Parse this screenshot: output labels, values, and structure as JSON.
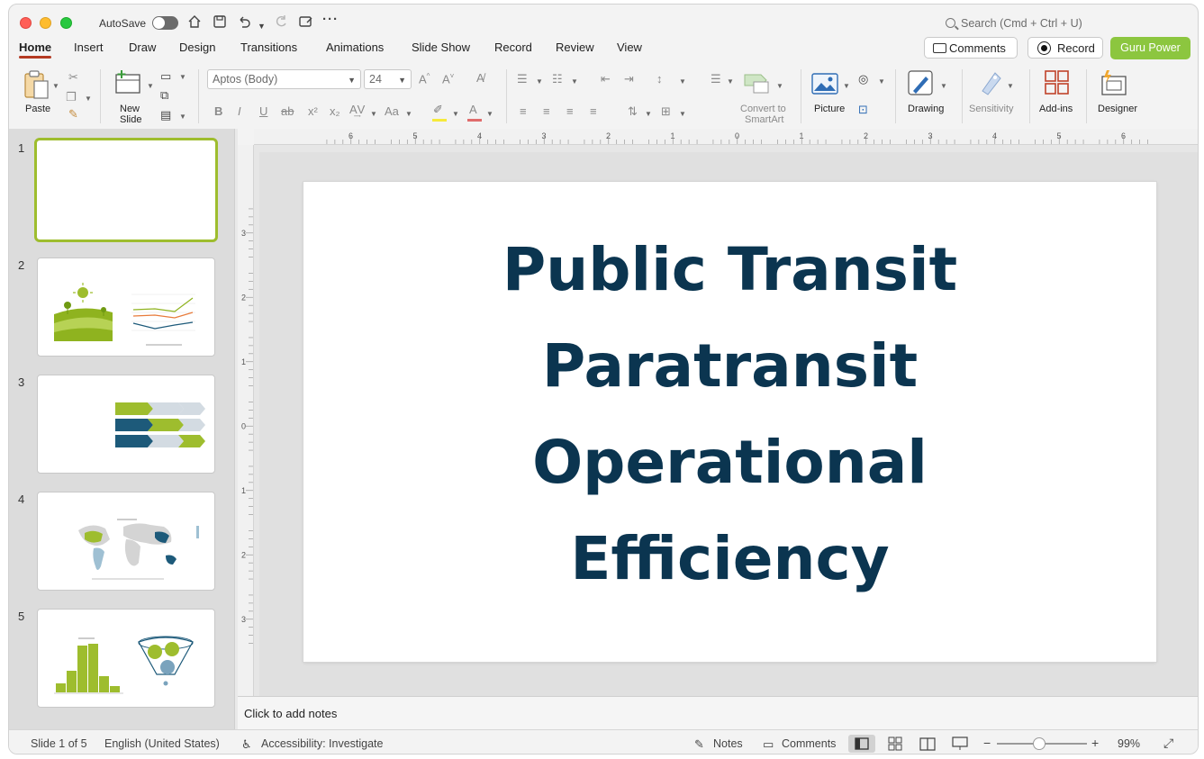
{
  "titlebar": {
    "autosave_label": "AutoSave",
    "search_placeholder": "Search (Cmd + Ctrl + U)"
  },
  "tabs": [
    "Home",
    "Insert",
    "Draw",
    "Design",
    "Transitions",
    "Animations",
    "Slide Show",
    "Record",
    "Review",
    "View"
  ],
  "header_buttons": {
    "comments": "Comments",
    "record": "Record",
    "guru": "Guru Power"
  },
  "ribbon": {
    "paste": "Paste",
    "new_slide_1": "New",
    "new_slide_2": "Slide",
    "font_name": "Aptos (Body)",
    "font_size": "24",
    "convert_1": "Convert to",
    "convert_2": "SmartArt",
    "picture": "Picture",
    "drawing": "Drawing",
    "sensitivity": "Sensitivity",
    "addins": "Add-ins",
    "designer": "Designer"
  },
  "slides": [
    {
      "number": "1"
    },
    {
      "number": "2"
    },
    {
      "number": "3"
    },
    {
      "number": "4"
    },
    {
      "number": "5"
    }
  ],
  "slide": {
    "lines": [
      "Public Transit",
      "Paratransit",
      "Operational",
      "Efficiency"
    ]
  },
  "notes_placeholder": "Click to add notes",
  "status": {
    "slide_count": "Slide 1 of 5",
    "language": "English (United States)",
    "accessibility": "Accessibility: Investigate",
    "notes": "Notes",
    "comments": "Comments",
    "zoom": "99%"
  },
  "colors": {
    "accent": "#8cc63f",
    "title": "#0b3550",
    "tab_underline": "#b43a22",
    "selection": "#9ebd2e"
  },
  "ruler_labels": {
    "horizontal": [
      "6",
      "5",
      "4",
      "3",
      "2",
      "1",
      "0",
      "1",
      "2",
      "3",
      "4",
      "5",
      "6"
    ],
    "vertical": [
      "3",
      "2",
      "1",
      "0",
      "1",
      "2",
      "3"
    ]
  }
}
